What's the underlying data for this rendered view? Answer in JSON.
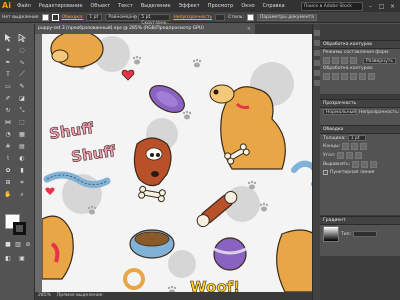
{
  "app": {
    "logo": "Ai"
  },
  "menu": [
    "Файл",
    "Редактирование",
    "Объект",
    "Текст",
    "Выделение",
    "Эффект",
    "Просмотр",
    "Окно",
    "Справка"
  ],
  "search": {
    "placeholder": "Поиск в Adobe Stock"
  },
  "control_bar": {
    "selection_label": "Нет выделения",
    "stroke_label": "Обводка:",
    "stroke_value": "1 pt",
    "profile_value": "Равномерно",
    "brush_value": "5 pt. Скругленн...",
    "opacity_link": "Непрозрачность",
    "style_label": "Стиль:",
    "doc_setup_button": "Параметры документа"
  },
  "document": {
    "tab_title": "puppy-set 3 [преобразованный].eps @ 285% (RGB/Предпросмотр GPU)",
    "close": "×"
  },
  "status": {
    "zoom": "285%",
    "tool": "Прямое выделение"
  },
  "panels": {
    "pathfinder": {
      "title": "Обработка контуров",
      "shape_modes": "Режимы составления форм:",
      "expand": "Развернуть",
      "pathfinders": "Обработка контуров:"
    },
    "transparency": {
      "title": "Прозрачность",
      "mode": "Нормальный",
      "opacity_label": "Непрозрачность:"
    },
    "stroke": {
      "title": "Обводка",
      "weight_label": "Толщина:",
      "weight_value": "1 pt",
      "cap_label": "Концы:",
      "corner_label": "Угол:",
      "align_label": "Выровнять:",
      "dashed_label": "Пунктирная линия"
    },
    "gradient": {
      "title": "Градиент",
      "type_label": "Тип:"
    }
  },
  "art_text": {
    "shuff1": "Shuff",
    "shuff2": "Shuff",
    "woof": "Woof!"
  },
  "colors": {
    "accent": "#ff9a00",
    "canvas": "#f4f4f4",
    "chrome": "#535353"
  }
}
